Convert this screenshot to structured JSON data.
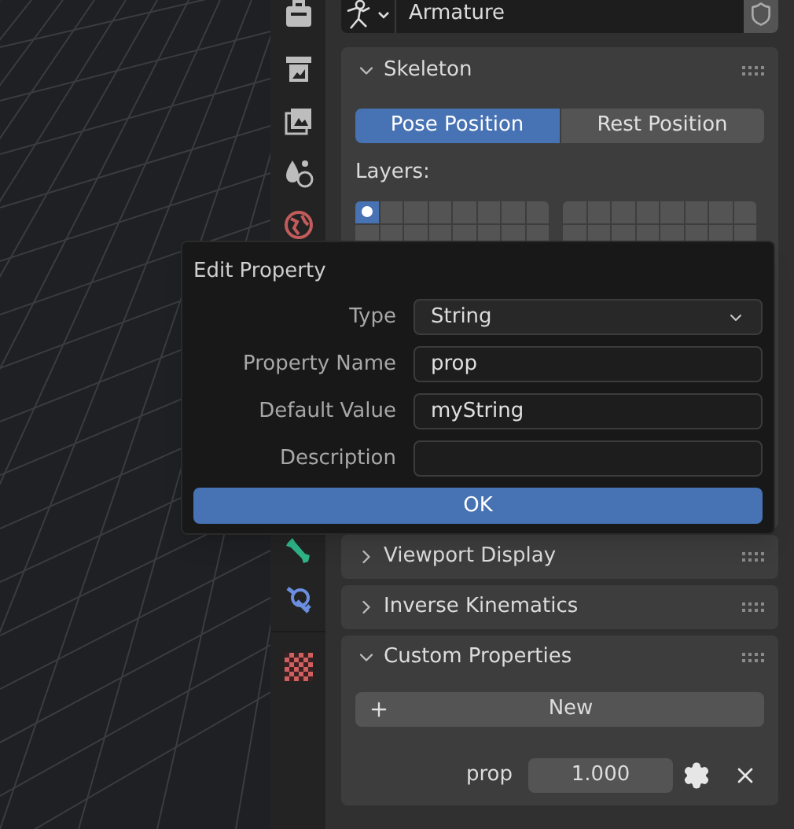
{
  "data_block": {
    "name": "Armature"
  },
  "skeleton": {
    "title": "Skeleton",
    "expanded": true,
    "position_buttons": [
      {
        "label": "Pose Position",
        "selected": true
      },
      {
        "label": "Rest Position",
        "selected": false
      }
    ],
    "layers_label": "Layers:",
    "layers": [
      {
        "selected": true
      },
      {
        "selected": false
      },
      {
        "selected": false
      },
      {
        "selected": false
      },
      {
        "selected": false
      },
      {
        "selected": false
      },
      {
        "selected": false
      },
      {
        "selected": false
      },
      {
        "selected": false
      },
      {
        "selected": false
      },
      {
        "selected": false
      },
      {
        "selected": false
      },
      {
        "selected": false
      },
      {
        "selected": false
      },
      {
        "selected": false
      },
      {
        "selected": false
      },
      {
        "selected": false
      },
      {
        "selected": false
      },
      {
        "selected": false
      },
      {
        "selected": false
      },
      {
        "selected": false
      },
      {
        "selected": false
      },
      {
        "selected": false
      },
      {
        "selected": false
      },
      {
        "selected": false
      },
      {
        "selected": false
      },
      {
        "selected": false
      },
      {
        "selected": false
      },
      {
        "selected": false
      },
      {
        "selected": false
      },
      {
        "selected": false
      },
      {
        "selected": false
      }
    ]
  },
  "panels": [
    {
      "title": "Viewport Display",
      "expanded": false
    },
    {
      "title": "Inverse Kinematics",
      "expanded": false
    }
  ],
  "custom_properties": {
    "title": "Custom Properties",
    "expanded": true,
    "new_button": "New",
    "properties": [
      {
        "name": "prop",
        "value": "1.000"
      }
    ]
  },
  "popup": {
    "title": "Edit Property",
    "fields": [
      {
        "kind": "dropdown",
        "label": "Type",
        "value": "String"
      },
      {
        "kind": "text",
        "label": "Property Name",
        "value": "prop"
      },
      {
        "kind": "text",
        "label": "Default Value",
        "value": "myString"
      },
      {
        "kind": "text",
        "label": "Description"
      }
    ],
    "ok_button": "OK"
  }
}
